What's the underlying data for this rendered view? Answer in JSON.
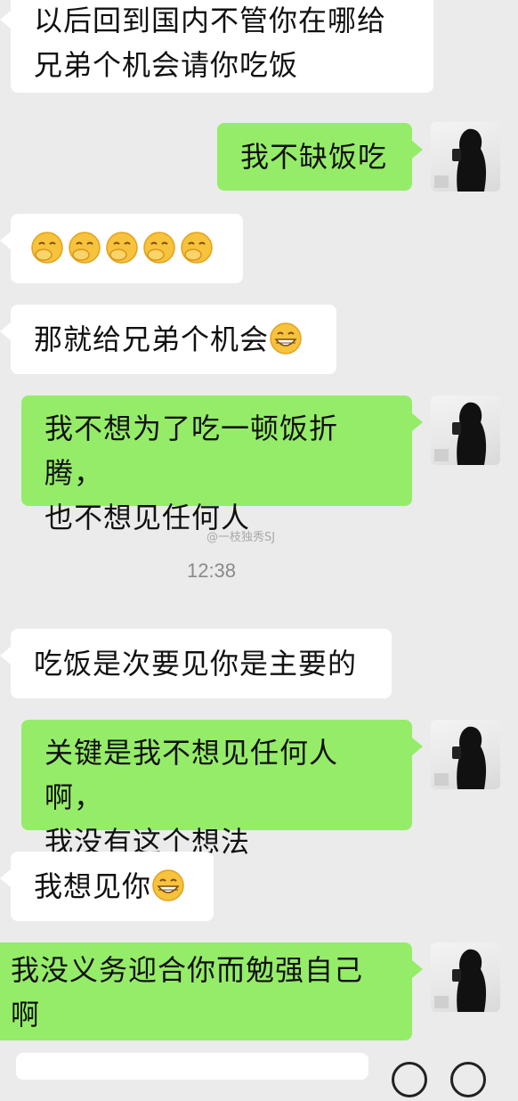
{
  "messages": [
    {
      "side": "left",
      "lines": [
        "以后回到国内不管你在哪给",
        "兄弟个机会请你吃饭"
      ]
    },
    {
      "side": "right",
      "lines": [
        "我不缺饭吃"
      ]
    },
    {
      "side": "left",
      "emoji_count": 5,
      "emoji_name": "covering-mouth-laugh-emoji"
    },
    {
      "side": "left",
      "lines": [
        "那就给兄弟个机会"
      ],
      "trailing_emoji": "grin-emoji"
    },
    {
      "side": "right",
      "lines": [
        "我不想为了吃一顿饭折腾，",
        "也不想见任何人"
      ]
    },
    {
      "side": "left",
      "lines": [
        "吃饭是次要见你是主要的"
      ]
    },
    {
      "side": "right",
      "lines": [
        "关键是我不想见任何人啊，",
        "我没有这个想法"
      ]
    },
    {
      "side": "left",
      "lines": [
        "我想见你"
      ],
      "trailing_emoji": "grin-emoji"
    },
    {
      "side": "right",
      "lines": [
        "我没义务迎合你而勉强自己",
        "啊"
      ]
    }
  ],
  "timestamp": "12:38",
  "watermark": "@一枝独秀SJ",
  "colors": {
    "background": "#ebebeb",
    "left_bubble": "#ffffff",
    "right_bubble": "#95ec69"
  }
}
